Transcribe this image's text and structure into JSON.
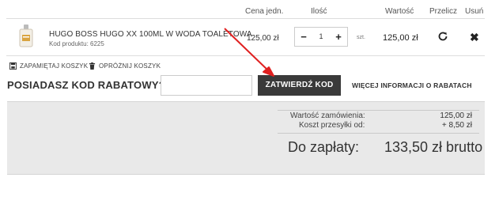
{
  "table_header": {
    "unit_price": "Cena jedn.",
    "quantity": "Ilość",
    "value": "Wartość",
    "recalculate": "Przelicz",
    "remove": "Usuń"
  },
  "cart_item": {
    "name": "HUGO BOSS HUGO XX 100ML W WODA TOALETOWA",
    "code": "Kod produktu: 6225",
    "unit_price": "125,00 zł",
    "quantity": "1",
    "unit": "szt.",
    "total": "125,00 zł",
    "minus_label": "−",
    "plus_label": "+"
  },
  "actions": {
    "save_cart": "ZAPAMIĘTAJ KOSZYK",
    "empty_cart": "OPRÓŻNIJ KOSZYK"
  },
  "coupon": {
    "title": "POSIADASZ KOD RABATOWY?",
    "input_value": "",
    "submit_label": "ZATWIERDŹ KOD",
    "more_info": "WIĘCEJ INFORMACJI O RABATACH"
  },
  "summary": {
    "order_value_label": "Wartość zamówienia:",
    "order_value": "125,00 zł",
    "shipping_label": "Koszt przesyłki od:",
    "shipping_value": "+ 8,50 zł",
    "to_pay_label": "Do zapłaty:",
    "to_pay_value": "133,50 zł brutto"
  },
  "colors": {
    "annotation_arrow": "#e02020",
    "button_dark": "#3a3a3a",
    "summary_bg": "#e9e9e9"
  },
  "icons": {
    "product": "perfume-bottle-icon",
    "recalculate": "refresh-icon",
    "remove": "close-icon",
    "save_cart": "save-icon",
    "empty_cart": "trash-icon"
  }
}
